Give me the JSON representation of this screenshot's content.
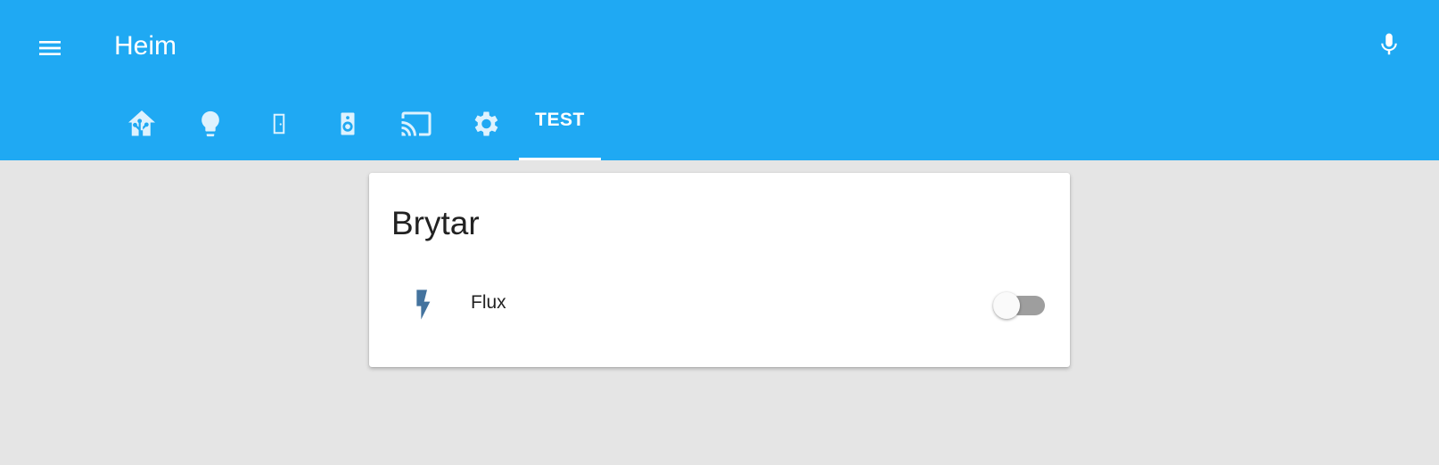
{
  "header": {
    "title": "Heim",
    "menu_icon": "menu-icon",
    "mic_icon": "microphone-icon",
    "background_color": "#1fa9f3"
  },
  "tabs": [
    {
      "icon": "home-assistant-icon",
      "active": false
    },
    {
      "icon": "lightbulb-icon",
      "active": false
    },
    {
      "icon": "door-icon",
      "active": false
    },
    {
      "icon": "speaker-icon",
      "active": false
    },
    {
      "icon": "cast-icon",
      "active": false
    },
    {
      "icon": "gear-icon",
      "active": false
    },
    {
      "label": "TEST",
      "active": true
    }
  ],
  "card": {
    "title": "Brytar",
    "rows": [
      {
        "label": "Flux",
        "icon": "flash-icon",
        "icon_color": "#44739e",
        "state": "off"
      }
    ]
  },
  "colors": {
    "page_background": "#e5e5e5",
    "toggle_off_track": "#9e9e9e"
  }
}
